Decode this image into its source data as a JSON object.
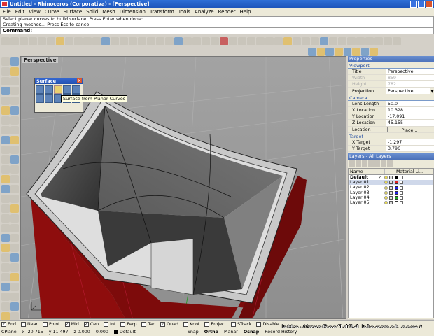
{
  "app": {
    "title": "Untitled - Rhinoceros (Corporativa) - [Perspective]"
  },
  "menu": [
    "File",
    "Edit",
    "View",
    "Curve",
    "Surface",
    "Solid",
    "Mesh",
    "Dimension",
    "Transform",
    "Tools",
    "Analyze",
    "Render",
    "Help"
  ],
  "command_history": [
    "Select planar curves to build surface. Press Enter when done:",
    "Creating meshes... Press Esc to cancel"
  ],
  "command": {
    "label": "Command:"
  },
  "viewport": {
    "title": "Perspective"
  },
  "surface_palette": {
    "title": "Surface",
    "tooltip": "Surface from Planar Curves"
  },
  "properties": {
    "header": "Properties",
    "viewport_section": "Viewport",
    "viewport_rows": [
      {
        "label": "Title",
        "value": "Perspective"
      },
      {
        "label": "Width",
        "value": "859"
      },
      {
        "label": "Height",
        "value": "782"
      },
      {
        "label": "Projection",
        "value": "Perspective"
      }
    ],
    "camera_section": "Camera",
    "camera_rows": [
      {
        "label": "Lens Length",
        "value": "50.0"
      },
      {
        "label": "X Location",
        "value": "10.328"
      },
      {
        "label": "Y Location",
        "value": "-17.091"
      },
      {
        "label": "Z Location",
        "value": "45.155"
      },
      {
        "label": "Location",
        "value": "Place..."
      }
    ],
    "target_section": "Target",
    "target_rows": [
      {
        "label": "X Target",
        "value": "-1.297"
      },
      {
        "label": "Y Target",
        "value": "3.796"
      }
    ]
  },
  "layers": {
    "header": "Layers - All Layers",
    "col_name": "Name",
    "col_material": "Material Li...",
    "rows": [
      {
        "name": "Default",
        "current": "✓",
        "color": "#000000"
      },
      {
        "name": "Layer 01",
        "current": "",
        "color": "#e02020"
      },
      {
        "name": "Layer 02",
        "current": "",
        "color": "#2020e0"
      },
      {
        "name": "Layer 03",
        "current": "",
        "color": "#2020e0"
      },
      {
        "name": "Layer 04",
        "current": "",
        "color": "#20a020"
      },
      {
        "name": "Layer 05",
        "current": "",
        "color": "#ffffff"
      }
    ]
  },
  "osnaps": [
    {
      "label": "End",
      "checked": true
    },
    {
      "label": "Near",
      "checked": false
    },
    {
      "label": "Point",
      "checked": false
    },
    {
      "label": "Mid",
      "checked": true
    },
    {
      "label": "Cen",
      "checked": true
    },
    {
      "label": "Int",
      "checked": false
    },
    {
      "label": "Perp",
      "checked": false
    },
    {
      "label": "Tan",
      "checked": false
    },
    {
      "label": "Quad",
      "checked": true
    },
    {
      "label": "Knot",
      "checked": false
    },
    {
      "label": "Project",
      "checked": false
    },
    {
      "label": "STrack",
      "checked": false
    },
    {
      "label": "Disable",
      "checked": false
    }
  ],
  "coords": {
    "cplane": "CPlane",
    "x": "x -20.715",
    "y": "y 11.497",
    "z": "z 0.000",
    "d": "0.000",
    "layer": "Default",
    "snap": "Snap",
    "ortho": "Ortho",
    "planar": "Planar",
    "osnap": "Osnap",
    "history": "Record History"
  },
  "watermark": "http://grafica2d3d.blogspot.com/",
  "colors": {
    "accent": "#2f6fd6",
    "model_red": "#8b0a0a",
    "model_grey": "#4a4a4a"
  }
}
